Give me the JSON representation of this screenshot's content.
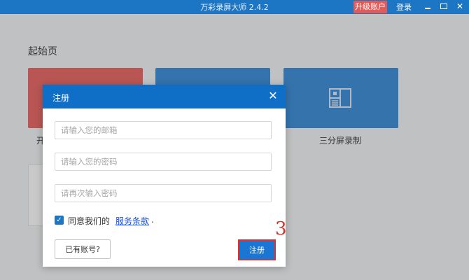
{
  "window": {
    "title": "万彩录屏大师 2.4.2",
    "upgrade_label": "升级账户",
    "login_label": "登录"
  },
  "start_page": {
    "title": "起始页",
    "tile_split_label": "三分屏录制",
    "tile_left_label_fragment": "开"
  },
  "dialog": {
    "title": "注册",
    "email_placeholder": "请输入您的邮箱",
    "password_placeholder": "请输入您的密码",
    "confirm_placeholder": "请再次输入密码",
    "agree_text": "同意我们的",
    "terms_link": "服务条款",
    "terms_period": ".",
    "has_account_button": "已有账号?",
    "register_button": "注册"
  },
  "annotation": {
    "step_number": "3"
  },
  "colors": {
    "titlebar": "#1c76c4",
    "dialog_header": "#0f6fc6",
    "tile_red": "#e9605c",
    "tile_blue": "#3288d8",
    "highlight": "#d9332e"
  }
}
